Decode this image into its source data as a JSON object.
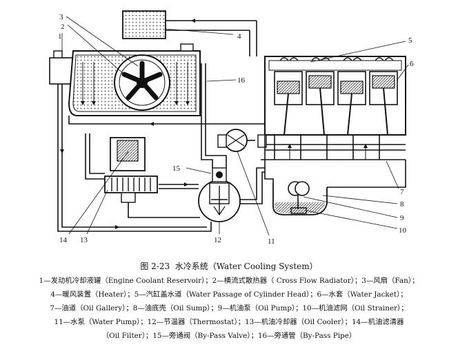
{
  "figure": {
    "number": "图 2-23",
    "title": "水冷系统（Water Cooling System）"
  },
  "callouts": [
    "1",
    "2",
    "3",
    "4",
    "5",
    "6",
    "7",
    "8",
    "9",
    "10",
    "11",
    "12",
    "13",
    "14",
    "15",
    "16"
  ],
  "legend_lines": [
    "1—发动机冷却液罐（Engine Coolant Reservoir）；2—横流式散热器（ Cross Flow Radiator）；3—风扇（Fan）；",
    "4—暖风装置（Heater）；5—汽缸盖水道（Water Passage of Cylinder Head）；6—水套（Water Jacket）；",
    "7—油道（Oil Gallery）；8—油底壳（Oil Sump）；9—机油泵（Oil Pump）；10—机油滤网（Oil Strainer）；",
    "11—水泵（Water Pump）；12—节温器（Thermostat）；13—机油冷却器（Oil Cooler）；14—机油滤清器",
    "（Oil Filter）；15—旁通阀（By-Pass Valve）；16—旁通管（By-Pass Pipe）"
  ]
}
